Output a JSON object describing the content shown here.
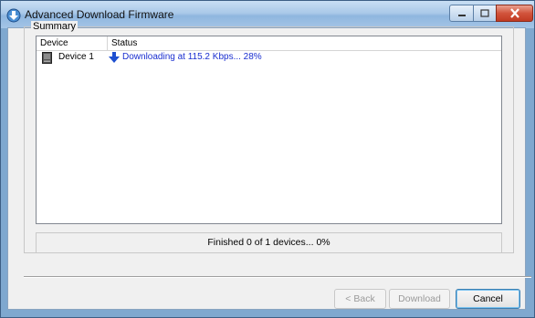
{
  "window": {
    "title": "Advanced Download Firmware"
  },
  "summary": {
    "group_label": "Summary",
    "columns": [
      "Device",
      "Status"
    ],
    "rows": [
      {
        "device": "Device 1",
        "status": "Downloading at 115.2 Kbps... 28%"
      }
    ],
    "progress_text": "Finished 0 of 1 devices... 0%"
  },
  "buttons": {
    "back": "< Back",
    "download": "Download",
    "cancel": "Cancel"
  },
  "colors": {
    "status_text": "#1a2fd0",
    "titlebar": "#a9c8e8",
    "close_button": "#d2543c"
  },
  "icons": {
    "app": "download-firmware-icon",
    "device": "device-icon",
    "status": "download-arrow-icon"
  }
}
